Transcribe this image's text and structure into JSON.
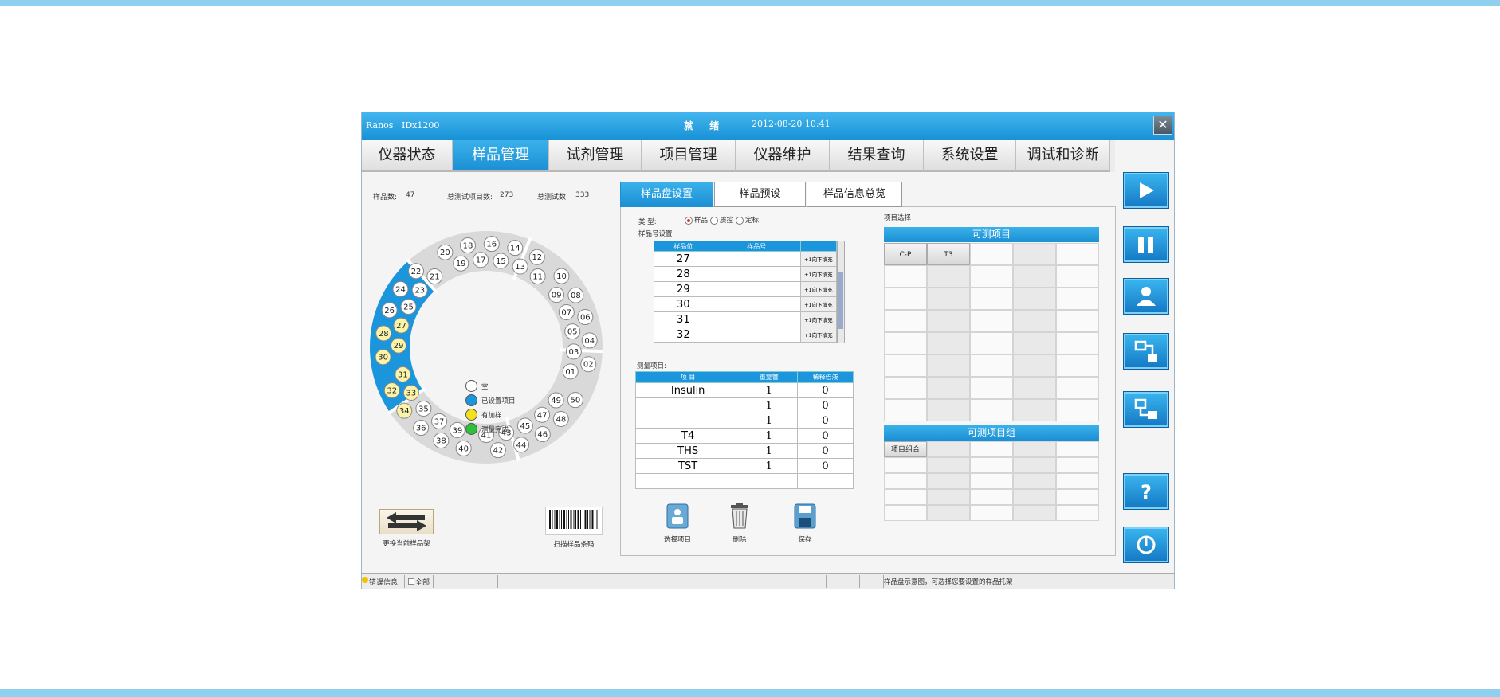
{
  "window": {
    "brand": "Ranos",
    "model": "IDx1200",
    "status": "就 绪",
    "datetime": "2012-08-20 10:41"
  },
  "menu": [
    "仪器状态",
    "样品管理",
    "试剂管理",
    "项目管理",
    "仪器维护",
    "结果查询",
    "系统设置",
    "调试和诊断"
  ],
  "menu_active": 1,
  "stats": {
    "sample_count_label": "样品数:",
    "sample_count": "47",
    "total_items_label": "总测试项目数:",
    "total_items": "273",
    "total_tests_label": "总测试数:",
    "total_tests": "333"
  },
  "tray": {
    "positions": [
      "01",
      "02",
      "03",
      "04",
      "05",
      "06",
      "07",
      "08",
      "09",
      "10",
      "11",
      "12",
      "13",
      "14",
      "15",
      "16",
      "17",
      "18",
      "19",
      "20",
      "21",
      "22",
      "23",
      "24",
      "25",
      "26",
      "27",
      "28",
      "29",
      "30",
      "31",
      "32",
      "33",
      "34",
      "35",
      "36",
      "37",
      "38",
      "39",
      "40",
      "41",
      "42",
      "43",
      "44",
      "45",
      "46",
      "47",
      "48",
      "49",
      "50"
    ],
    "set_positions": [
      "26",
      "27",
      "28",
      "29",
      "30",
      "31",
      "32",
      "33",
      "34",
      "35"
    ],
    "loaded_positions": [
      "27",
      "28",
      "29",
      "30",
      "31",
      "32",
      "33",
      "34"
    ]
  },
  "legend": [
    {
      "label": "空",
      "color": "#ffffff"
    },
    {
      "label": "已设置项目",
      "color": "#1b95dc"
    },
    {
      "label": "有加样",
      "color": "#f2e21a"
    },
    {
      "label": "测量完成",
      "color": "#2fbf3a"
    }
  ],
  "buttons": {
    "swap_rack": "更换当前样品架",
    "scan_barcode": "扫描样品条码",
    "select_item": "选择项目",
    "delete": "删除",
    "save": "保存"
  },
  "center_tabs": [
    "样品盘设置",
    "样品预设",
    "样品信息总览"
  ],
  "center_tab_active": 0,
  "type_row": {
    "label": "类  型:",
    "options": [
      "样品",
      "质控",
      "定标"
    ],
    "selected": 0
  },
  "sample_no_label": "样品号设置",
  "sample_table": {
    "headers": [
      "样品位",
      "样品号",
      ""
    ],
    "rows": [
      {
        "pos": "27",
        "no": "",
        "btn": "+1向下填充"
      },
      {
        "pos": "28",
        "no": "",
        "btn": "+1向下填充"
      },
      {
        "pos": "29",
        "no": "",
        "btn": "+1向下填充"
      },
      {
        "pos": "30",
        "no": "",
        "btn": "+1向下填充"
      },
      {
        "pos": "31",
        "no": "",
        "btn": "+1向下填充"
      },
      {
        "pos": "32",
        "no": "",
        "btn": "+1向下填充"
      }
    ]
  },
  "measure_label": "测量项目:",
  "measure_table": {
    "headers": [
      "项    目",
      "重复管",
      "稀释倍液"
    ],
    "rows": [
      {
        "item": "Insulin",
        "rep": "1",
        "dil": "0"
      },
      {
        "item": "",
        "rep": "1",
        "dil": "0"
      },
      {
        "item": "",
        "rep": "1",
        "dil": "0"
      },
      {
        "item": "T4",
        "rep": "1",
        "dil": "0"
      },
      {
        "item": "THS",
        "rep": "1",
        "dil": "0"
      },
      {
        "item": "TST",
        "rep": "1",
        "dil": "0"
      },
      {
        "item": "",
        "rep": "",
        "dil": ""
      }
    ]
  },
  "right_panel": {
    "label": "项目选择",
    "items_header": "可测项目",
    "items": [
      "C-P",
      "T3"
    ],
    "groups_header": "可测项目组",
    "groups": [
      "项目组合"
    ]
  },
  "side_buttons": [
    "play-icon",
    "pause-icon",
    "user-icon",
    "flow-icon",
    "transfer-icon",
    "help-icon",
    "power-icon"
  ],
  "statusbar": {
    "error_label": "错误信息",
    "all_label": "全部",
    "hint": "样品盘示意图，可选择您要设置的样品托架"
  }
}
